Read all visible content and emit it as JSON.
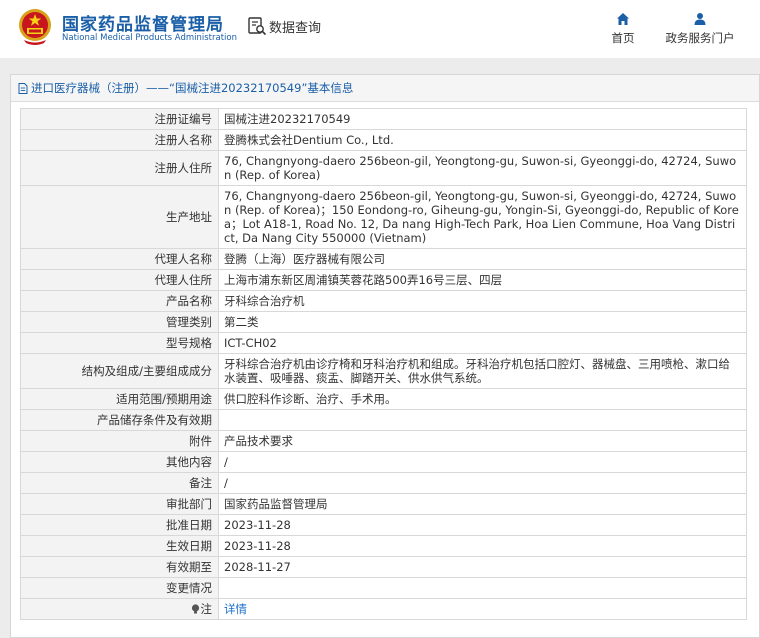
{
  "header": {
    "site_name_cn": "国家药品监督管理局",
    "site_name_en": "National Medical Products Administration",
    "query_label": "数据查询",
    "nav": {
      "home_label": "首页",
      "portal_label": "政务服务门户"
    }
  },
  "panel": {
    "title": "进口医疗器械（注册）——“国械注进20232170549”基本信息"
  },
  "rows": [
    {
      "label": "注册证编号",
      "value": "国械注进20232170549"
    },
    {
      "label": "注册人名称",
      "value": "登腾株式会社Dentium Co., Ltd."
    },
    {
      "label": "注册人住所",
      "value": "76, Changnyong-daero 256beon-gil, Yeongtong-gu, Suwon-si, Gyeonggi-do, 42724, Suwon (Rep. of Korea)"
    },
    {
      "label": "生产地址",
      "value": "76, Changnyong-daero 256beon-gil, Yeongtong-gu, Suwon-si, Gyeonggi-do, 42724, Suwon (Rep. of Korea)；150 Eondong-ro, Giheung-gu, Yongin-Si, Gyeonggi-do, Republic of Korea；Lot A18-1, Road No. 12, Da nang High-Tech Park, Hoa Lien Commune, Hoa Vang District, Da Nang City 550000 (Vietnam)"
    },
    {
      "label": "代理人名称",
      "value": "登腾（上海）医疗器械有限公司"
    },
    {
      "label": "代理人住所",
      "value": "上海市浦东新区周浦镇芙蓉花路500弄16号三层、四层"
    },
    {
      "label": "产品名称",
      "value": "牙科综合治疗机"
    },
    {
      "label": "管理类别",
      "value": "第二类"
    },
    {
      "label": "型号规格",
      "value": "ICT-CH02"
    },
    {
      "label": "结构及组成/主要组成成分",
      "value": "牙科综合治疗机由诊疗椅和牙科治疗机和组成。牙科治疗机包括口腔灯、器械盘、三用喷枪、漱口给水装置、吸唾器、痰盂、脚踏开关、供水供气系统。"
    },
    {
      "label": "适用范围/预期用途",
      "value": "供口腔科作诊断、治疗、手术用。"
    },
    {
      "label": "产品储存条件及有效期",
      "value": ""
    },
    {
      "label": "附件",
      "value": "产品技术要求"
    },
    {
      "label": "其他内容",
      "value": "/"
    },
    {
      "label": "备注",
      "value": "/"
    },
    {
      "label": "审批部门",
      "value": "国家药品监督管理局"
    },
    {
      "label": "批准日期",
      "value": "2023-11-28"
    },
    {
      "label": "生效日期",
      "value": "2023-11-28"
    },
    {
      "label": "有效期至",
      "value": "2028-11-27"
    },
    {
      "label": "变更情况",
      "value": ""
    }
  ],
  "note_row": {
    "label": "注",
    "link": "详情"
  },
  "icons": [
    "emblem-icon",
    "magnifier-doc-icon",
    "home-icon",
    "user-icon",
    "document-icon",
    "lightbulb-icon"
  ],
  "colors": {
    "brand_blue": "#1a5fa8",
    "link_blue": "#1a6fc9",
    "band_grey": "#ececec",
    "label_bg": "#f3f3f3"
  }
}
